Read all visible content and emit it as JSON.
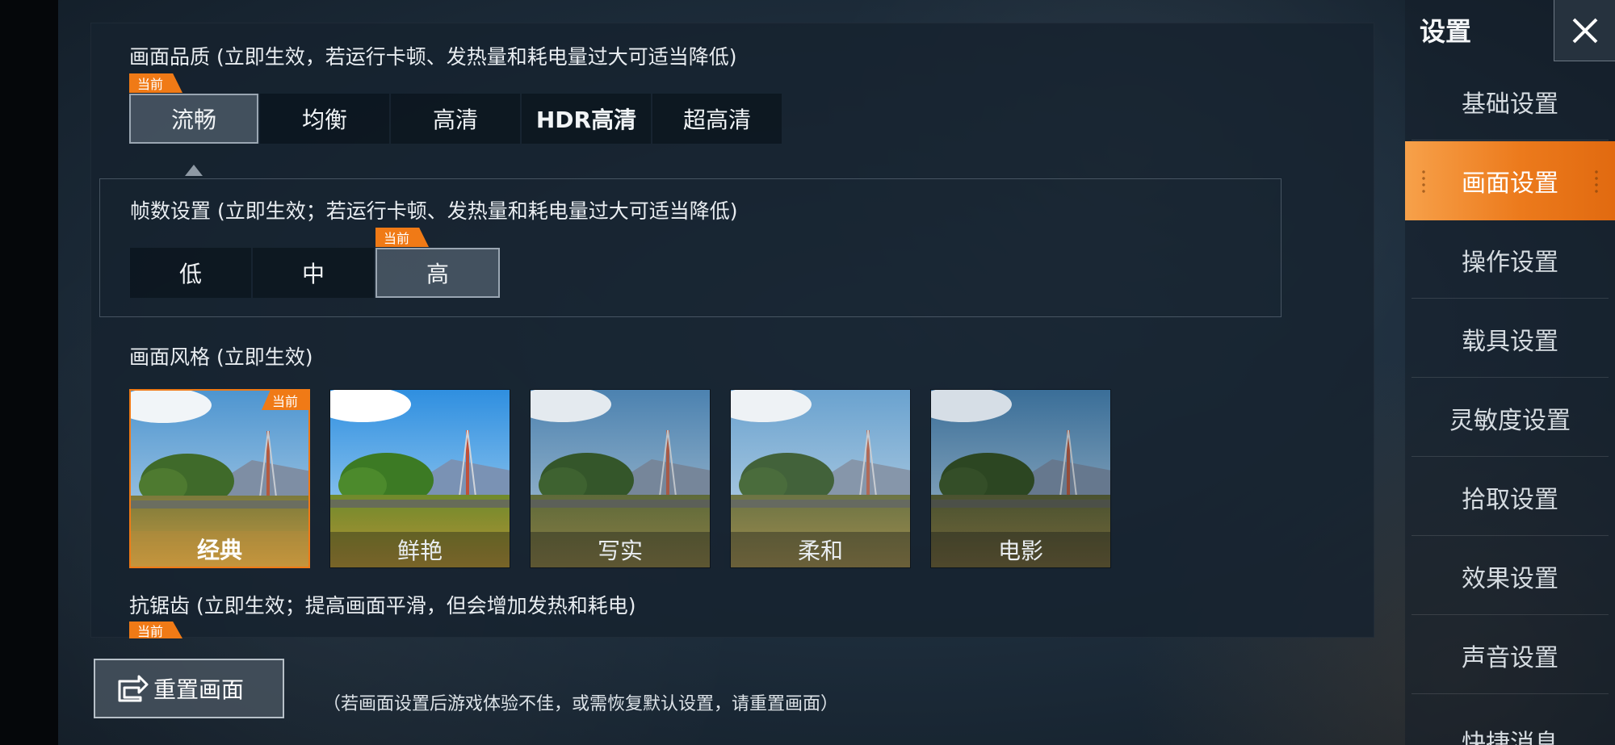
{
  "panel": {
    "quality": {
      "title": "画面品质 (立即生效，若运行卡顿、发热量和耗电量过大可适当降低)",
      "current_tag": "当前",
      "options": [
        "流畅",
        "均衡",
        "高清",
        "HDR高清",
        "超高清"
      ],
      "selected": "流畅"
    },
    "fps": {
      "title": "帧数设置 (立即生效；若运行卡顿、发热量和耗电量过大可适当降低)",
      "current_tag": "当前",
      "options": [
        "低",
        "中",
        "高"
      ],
      "selected": "高"
    },
    "style": {
      "title": "画面风格 (立即生效)",
      "current_tag": "当前",
      "options": [
        "经典",
        "鲜艳",
        "写实",
        "柔和",
        "电影"
      ],
      "selected": "经典"
    },
    "antialias": {
      "title": "抗锯齿 (立即生效；提高画面平滑，但会增加发热和耗电)",
      "current_tag": "当前"
    }
  },
  "footer": {
    "reset_label": "重置画面",
    "hint": "（若画面设置后游戏体验不佳，或需恢复默认设置，请重置画面）"
  },
  "sidebar": {
    "title": "设置",
    "close_icon": "close-icon",
    "items": [
      {
        "label": "基础设置"
      },
      {
        "label": "画面设置"
      },
      {
        "label": "操作设置"
      },
      {
        "label": "载具设置"
      },
      {
        "label": "灵敏度设置"
      },
      {
        "label": "拾取设置"
      },
      {
        "label": "效果设置"
      },
      {
        "label": "声音设置"
      },
      {
        "label": "快捷消息"
      }
    ],
    "active": "画面设置"
  },
  "colors": {
    "accent": "#f07a16",
    "panel_bg": "#16222e",
    "active_option_border": "#9aa6b2"
  }
}
